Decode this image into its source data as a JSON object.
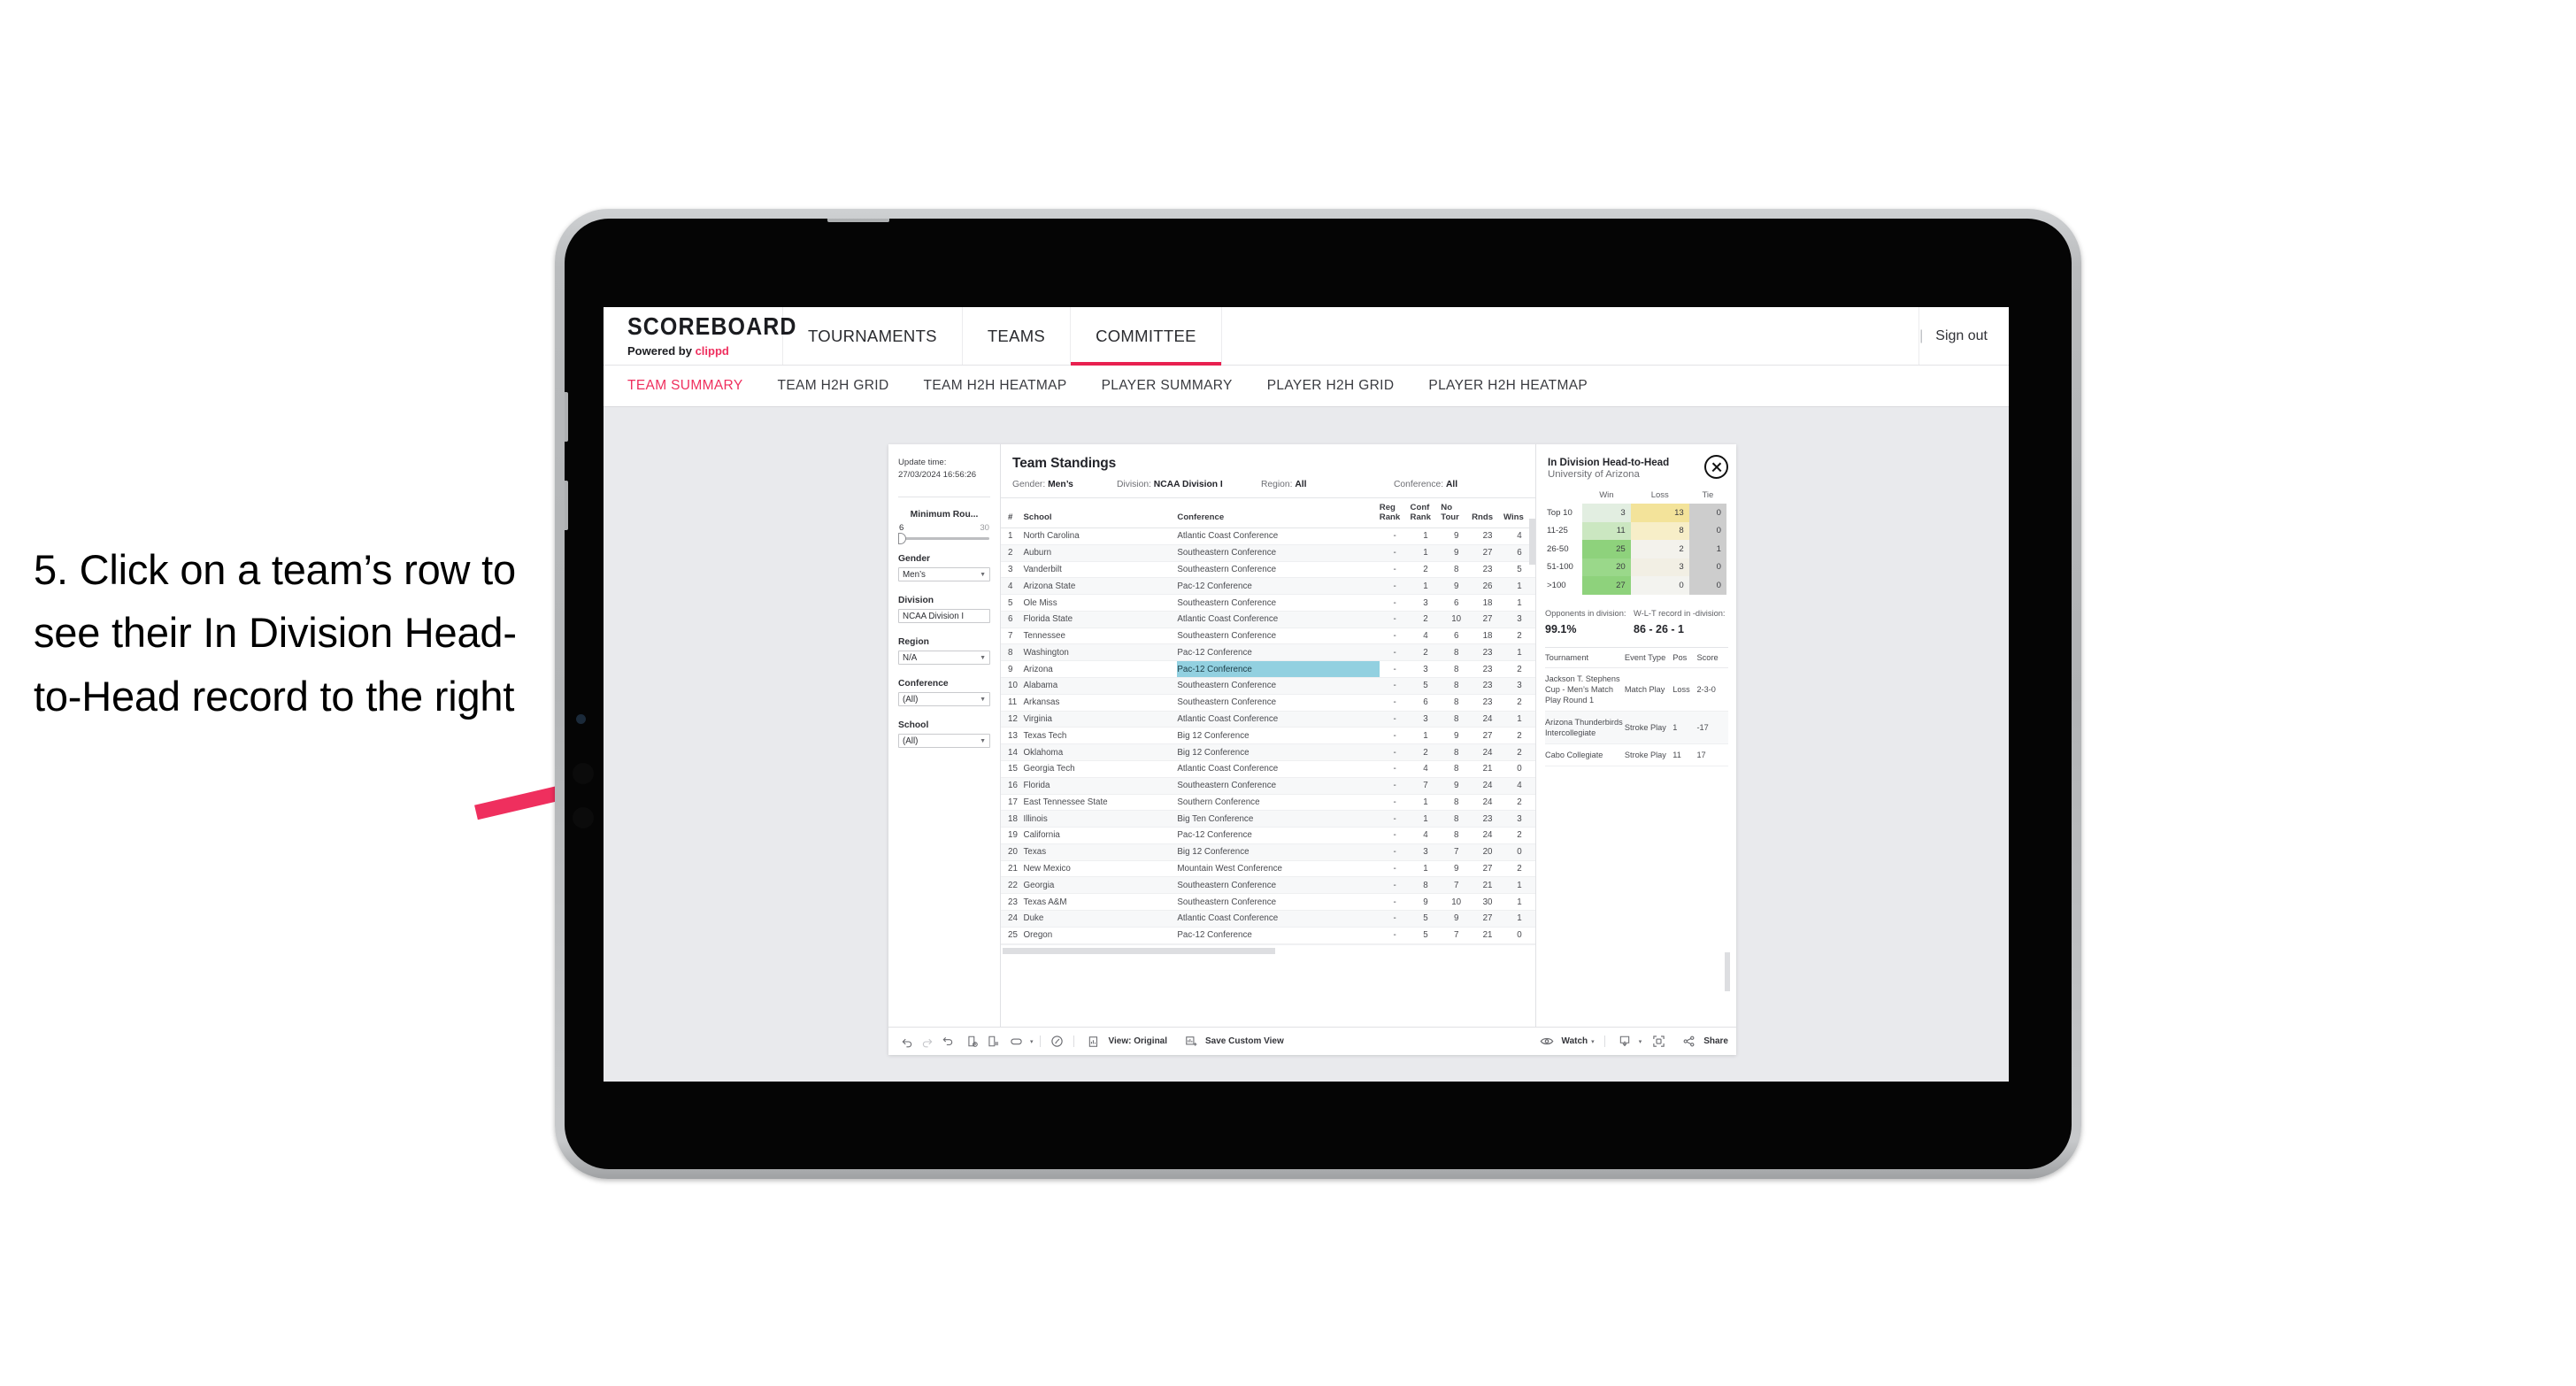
{
  "annotation": {
    "text": "5. Click on a team’s row to see their In Division Head-to-Head record to the right",
    "arrow_color": "#ef2f5e"
  },
  "topnav": {
    "brand_title": "SCOREBOARD",
    "brand_sub_prefix": "Powered by ",
    "brand_sub_accent": "clippd",
    "items": [
      {
        "label": "TOURNAMENTS",
        "active": false
      },
      {
        "label": "TEAMS",
        "active": false
      },
      {
        "label": "COMMITTEE",
        "active": true
      }
    ],
    "divider": "|",
    "sign_out": "Sign out",
    "accent": "#e8204f"
  },
  "subnav": {
    "items": [
      {
        "label": "TEAM SUMMARY",
        "active": true
      },
      {
        "label": "TEAM H2H GRID",
        "active": false
      },
      {
        "label": "TEAM H2H HEATMAP",
        "active": false
      },
      {
        "label": "PLAYER SUMMARY",
        "active": false
      },
      {
        "label": "PLAYER H2H GRID",
        "active": false
      },
      {
        "label": "PLAYER H2H HEATMAP",
        "active": false
      }
    ]
  },
  "filters": {
    "update_time_label": "Update time:",
    "update_time_value": "27/03/2024 16:56:26",
    "min_rounds": {
      "label": "Minimum Rou...",
      "low": "6",
      "high": "30"
    },
    "groups": [
      {
        "label": "Gender",
        "value": "Men’s"
      },
      {
        "label": "Division",
        "value": "NCAA Division I"
      },
      {
        "label": "Region",
        "value": "N/A"
      },
      {
        "label": "Conference",
        "value": "(All)"
      },
      {
        "label": "School",
        "value": "(All)"
      }
    ]
  },
  "standings": {
    "title": "Team Standings",
    "meta": [
      {
        "label": "Gender:",
        "value": "Men’s"
      },
      {
        "label": "Division:",
        "value": "NCAA Division I"
      },
      {
        "label": "Region:",
        "value": "All"
      },
      {
        "label": "Conference:",
        "value": "All"
      }
    ],
    "columns": [
      "#",
      "School",
      "Conference",
      "Reg Rank",
      "Conf Rank",
      "No Tour",
      "Rnds",
      "Wins"
    ],
    "rows": [
      {
        "num": "1",
        "school": "North Carolina",
        "conference": "Atlantic Coast Conference",
        "reg": "-",
        "conf": "1",
        "notour": "9",
        "rnds": "23",
        "wins": "4"
      },
      {
        "num": "2",
        "school": "Auburn",
        "conference": "Southeastern Conference",
        "reg": "-",
        "conf": "1",
        "notour": "9",
        "rnds": "27",
        "wins": "6"
      },
      {
        "num": "3",
        "school": "Vanderbilt",
        "conference": "Southeastern Conference",
        "reg": "-",
        "conf": "2",
        "notour": "8",
        "rnds": "23",
        "wins": "5"
      },
      {
        "num": "4",
        "school": "Arizona State",
        "conference": "Pac-12 Conference",
        "reg": "-",
        "conf": "1",
        "notour": "9",
        "rnds": "26",
        "wins": "1"
      },
      {
        "num": "5",
        "school": "Ole Miss",
        "conference": "Southeastern Conference",
        "reg": "-",
        "conf": "3",
        "notour": "6",
        "rnds": "18",
        "wins": "1"
      },
      {
        "num": "6",
        "school": "Florida State",
        "conference": "Atlantic Coast Conference",
        "reg": "-",
        "conf": "2",
        "notour": "10",
        "rnds": "27",
        "wins": "3"
      },
      {
        "num": "7",
        "school": "Tennessee",
        "conference": "Southeastern Conference",
        "reg": "-",
        "conf": "4",
        "notour": "6",
        "rnds": "18",
        "wins": "2"
      },
      {
        "num": "8",
        "school": "Washington",
        "conference": "Pac-12 Conference",
        "reg": "-",
        "conf": "2",
        "notour": "8",
        "rnds": "23",
        "wins": "1"
      },
      {
        "num": "9",
        "school": "Arizona",
        "conference": "Pac-12 Conference",
        "reg": "-",
        "conf": "3",
        "notour": "8",
        "rnds": "23",
        "wins": "2",
        "selected": true
      },
      {
        "num": "10",
        "school": "Alabama",
        "conference": "Southeastern Conference",
        "reg": "-",
        "conf": "5",
        "notour": "8",
        "rnds": "23",
        "wins": "3"
      },
      {
        "num": "11",
        "school": "Arkansas",
        "conference": "Southeastern Conference",
        "reg": "-",
        "conf": "6",
        "notour": "8",
        "rnds": "23",
        "wins": "2"
      },
      {
        "num": "12",
        "school": "Virginia",
        "conference": "Atlantic Coast Conference",
        "reg": "-",
        "conf": "3",
        "notour": "8",
        "rnds": "24",
        "wins": "1"
      },
      {
        "num": "13",
        "school": "Texas Tech",
        "conference": "Big 12 Conference",
        "reg": "-",
        "conf": "1",
        "notour": "9",
        "rnds": "27",
        "wins": "2"
      },
      {
        "num": "14",
        "school": "Oklahoma",
        "conference": "Big 12 Conference",
        "reg": "-",
        "conf": "2",
        "notour": "8",
        "rnds": "24",
        "wins": "2"
      },
      {
        "num": "15",
        "school": "Georgia Tech",
        "conference": "Atlantic Coast Conference",
        "reg": "-",
        "conf": "4",
        "notour": "8",
        "rnds": "21",
        "wins": "0"
      },
      {
        "num": "16",
        "school": "Florida",
        "conference": "Southeastern Conference",
        "reg": "-",
        "conf": "7",
        "notour": "9",
        "rnds": "24",
        "wins": "4"
      },
      {
        "num": "17",
        "school": "East Tennessee State",
        "conference": "Southern Conference",
        "reg": "-",
        "conf": "1",
        "notour": "8",
        "rnds": "24",
        "wins": "2"
      },
      {
        "num": "18",
        "school": "Illinois",
        "conference": "Big Ten Conference",
        "reg": "-",
        "conf": "1",
        "notour": "8",
        "rnds": "23",
        "wins": "3"
      },
      {
        "num": "19",
        "school": "California",
        "conference": "Pac-12 Conference",
        "reg": "-",
        "conf": "4",
        "notour": "8",
        "rnds": "24",
        "wins": "2"
      },
      {
        "num": "20",
        "school": "Texas",
        "conference": "Big 12 Conference",
        "reg": "-",
        "conf": "3",
        "notour": "7",
        "rnds": "20",
        "wins": "0"
      },
      {
        "num": "21",
        "school": "New Mexico",
        "conference": "Mountain West Conference",
        "reg": "-",
        "conf": "1",
        "notour": "9",
        "rnds": "27",
        "wins": "2"
      },
      {
        "num": "22",
        "school": "Georgia",
        "conference": "Southeastern Conference",
        "reg": "-",
        "conf": "8",
        "notour": "7",
        "rnds": "21",
        "wins": "1"
      },
      {
        "num": "23",
        "school": "Texas A&M",
        "conference": "Southeastern Conference",
        "reg": "-",
        "conf": "9",
        "notour": "10",
        "rnds": "30",
        "wins": "1"
      },
      {
        "num": "24",
        "school": "Duke",
        "conference": "Atlantic Coast Conference",
        "reg": "-",
        "conf": "5",
        "notour": "9",
        "rnds": "27",
        "wins": "1"
      },
      {
        "num": "25",
        "school": "Oregon",
        "conference": "Pac-12 Conference",
        "reg": "-",
        "conf": "5",
        "notour": "7",
        "rnds": "21",
        "wins": "0"
      }
    ]
  },
  "h2h": {
    "title": "In Division Head-to-Head",
    "subtitle": "University of Arizona",
    "close_icon": "close-icon",
    "columns": [
      "Win",
      "Loss",
      "Tie"
    ],
    "rows": [
      {
        "band": "Top 10",
        "win": "3",
        "loss": "13",
        "tie": "0",
        "win_color": "#e2eee1",
        "loss_color": "#f3e39a",
        "tie_color": "#cdcdcd"
      },
      {
        "band": "11-25",
        "win": "11",
        "loss": "8",
        "tie": "0",
        "win_color": "#cbe7c1",
        "loss_color": "#f7eec8",
        "tie_color": "#cdcdcd"
      },
      {
        "band": "26-50",
        "win": "25",
        "loss": "2",
        "tie": "1",
        "win_color": "#8ed27c",
        "loss_color": "#f3f2ec",
        "tie_color": "#cdcdcd"
      },
      {
        "band": "51-100",
        "win": "20",
        "loss": "3",
        "tie": "0",
        "win_color": "#9ad88a",
        "loss_color": "#f2efe4",
        "tie_color": "#cdcdcd"
      },
      {
        "band": ">100",
        "win": "27",
        "loss": "0",
        "tie": "0",
        "win_color": "#8ed27c",
        "loss_color": "#f3f3ef",
        "tie_color": "#cdcdcd"
      }
    ],
    "stats": [
      {
        "label": "Opponents in division:",
        "value": "99.1%"
      },
      {
        "label": "W-L-T record in -division:",
        "value": "86 - 26 - 1"
      }
    ],
    "events_columns": [
      "Tournament",
      "Event Type",
      "Pos",
      "Score"
    ],
    "events": [
      {
        "tournament": "Jackson T. Stephens Cup - Men’s Match Play Round 1",
        "type": "Match Play",
        "pos": "Loss",
        "score": "2-3-0"
      },
      {
        "tournament": "Arizona Thunderbirds Intercollegiate",
        "type": "Stroke Play",
        "pos": "1",
        "score": "-17"
      },
      {
        "tournament": "Cabo Collegiate",
        "type": "Stroke Play",
        "pos": "11",
        "score": "17"
      }
    ]
  },
  "toolbar": {
    "icons": [
      "undo-icon",
      "redo-icon",
      "revert-icon",
      "refresh-data-icon",
      "pause-updates-icon",
      "shape-icon"
    ],
    "view_label": "View: Original",
    "save_label": "Save Custom View",
    "watch_label": "Watch",
    "share_label": "Share",
    "view_icon": "view-icon",
    "save_icon": "save-view-icon",
    "watch_icon": "eye-icon",
    "download_icon": "download-icon",
    "fullscreen_icon": "fullscreen-icon",
    "share_icon": "share-icon",
    "caret": "▾"
  }
}
